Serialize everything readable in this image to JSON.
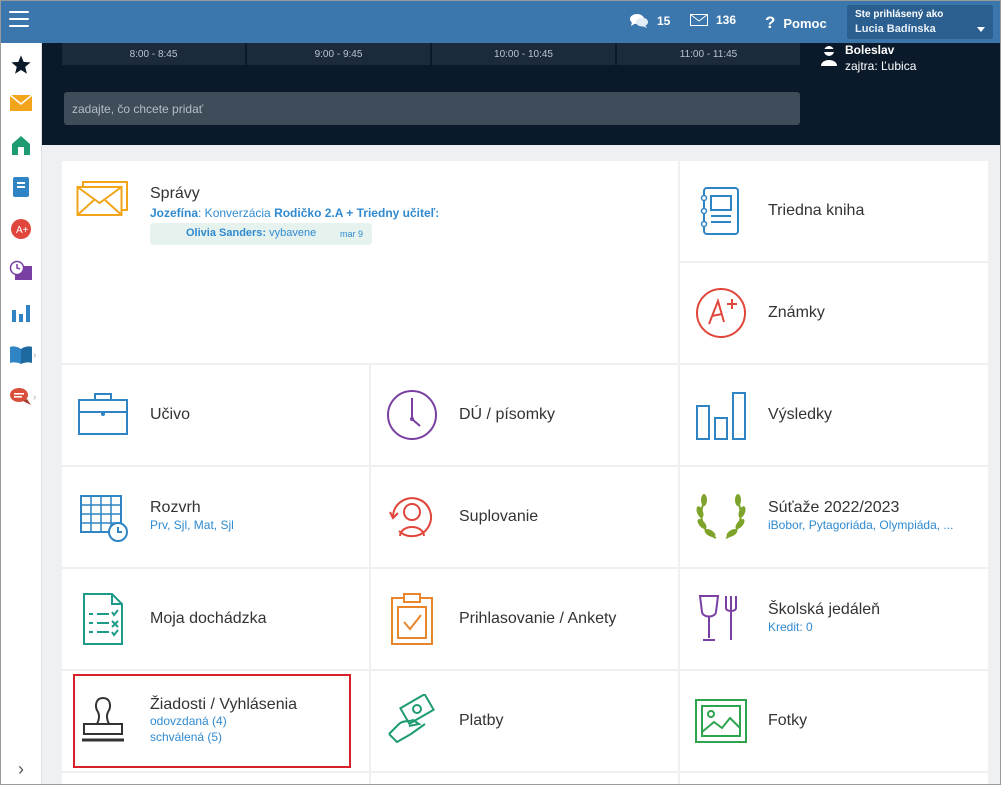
{
  "topbar": {
    "messages_count": "15",
    "mail_count": "136",
    "help_label": "Pomoc",
    "user_box": {
      "label": "Ste prihlásený ako",
      "name": "Lucia Badínska"
    }
  },
  "timeline": {
    "slots": [
      "8:00 - 8:45",
      "9:00 - 9:45",
      "10:00 - 10:45",
      "11:00 - 11:45"
    ]
  },
  "add_input": {
    "placeholder": "zadajte, čo chcete pridať"
  },
  "nameday": {
    "today": "Boleslav",
    "tomorrow": "zajtra: Ľubica"
  },
  "tiles": {
    "spravy": {
      "title": "Správy",
      "from": "Jozefína",
      "mid": ": Konverzácia ",
      "bold": "Rodičko 2.A + Triedny učiteľ:",
      "reply_name": "Olivia Sanders:",
      "reply_text": " vybavene",
      "reply_date": "mar 9"
    },
    "triedna_kniha": {
      "title": "Triedna kniha"
    },
    "znamky": {
      "title": "Známky"
    },
    "ucivo": {
      "title": "Učivo"
    },
    "du": {
      "title": "DÚ / písomky"
    },
    "vysledky": {
      "title": "Výsledky"
    },
    "rozvrh": {
      "title": "Rozvrh",
      "sub": "Prv, Sjl, Mat, Sjl"
    },
    "suplovanie": {
      "title": "Suplovanie"
    },
    "sutaze": {
      "title": "Súťaže 2022/2023",
      "sub": "iBobor, Pytagoriáda, Olympiáda, ..."
    },
    "dochadzka": {
      "title": "Moja dochádzka"
    },
    "prihlasovanie": {
      "title": "Prihlasovanie / Ankety"
    },
    "jedalen": {
      "title": "Školská jedáleň",
      "sub": "Kredit: 0"
    },
    "ziadosti": {
      "title": "Žiadosti / Vyhlásenia",
      "sub1": "odovzdaná (4)",
      "sub2": "schválená (5)"
    },
    "platby": {
      "title": "Platby"
    },
    "fotky": {
      "title": "Fotky"
    }
  },
  "colors": {
    "topbar": "#3b77ad",
    "dark_header": "#0b1a2a",
    "link": "#2f8ad0",
    "highlight": "#d6202a"
  }
}
